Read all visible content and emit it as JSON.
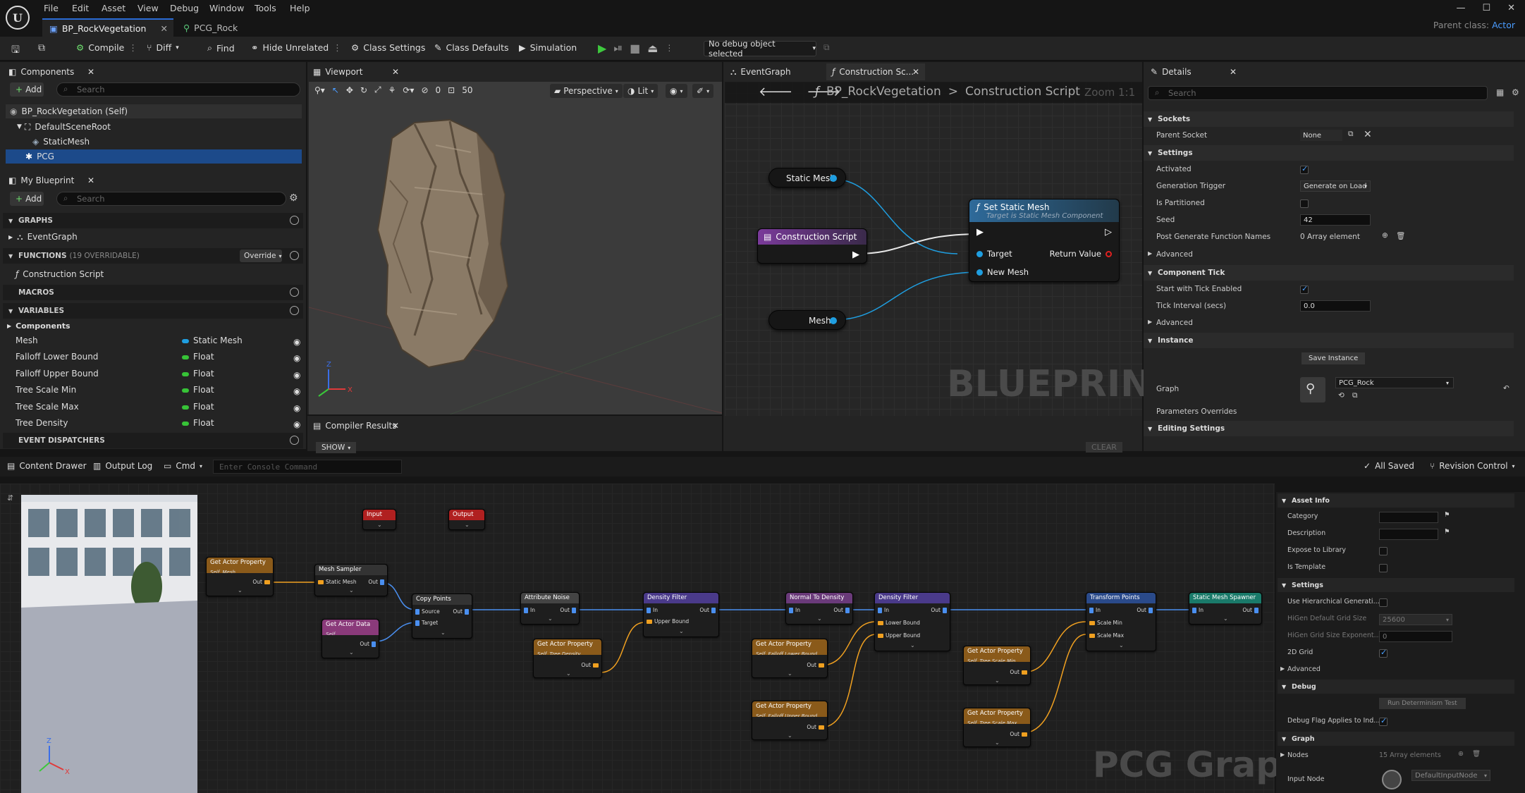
{
  "menu": [
    "File",
    "Edit",
    "Asset",
    "View",
    "Debug",
    "Window",
    "Tools",
    "Help"
  ],
  "tabs": {
    "tab1": "BP_RockVegetation",
    "tab2": "PCG_Rock"
  },
  "parent_class": {
    "label": "Parent class:",
    "value": "Actor"
  },
  "toolbar": {
    "compile": "Compile",
    "diff": "Diff",
    "find": "Find",
    "hide_unrelated": "Hide Unrelated",
    "class_settings": "Class Settings",
    "class_defaults": "Class Defaults",
    "simulation": "Simulation",
    "debug_object": "No debug object selected"
  },
  "components_panel": {
    "title": "Components",
    "add": "Add",
    "search_placeholder": "Search",
    "items": [
      "BP_RockVegetation (Self)",
      "DefaultSceneRoot",
      "StaticMesh",
      "PCG"
    ]
  },
  "my_blueprint": {
    "title": "My Blueprint",
    "add": "Add",
    "search_placeholder": "Search",
    "graphs_header": "GRAPHS",
    "event_graph": "EventGraph",
    "functions_header": "FUNCTIONS",
    "functions_count": "(19 OVERRIDABLE)",
    "override": "Override",
    "construction_script": "Construction Script",
    "macros_header": "MACROS",
    "variables_header": "VARIABLES",
    "components_group": "Components",
    "variables": [
      {
        "name": "Mesh",
        "type": "Static Mesh",
        "color": "#1f9ee0"
      },
      {
        "name": "Falloff Lower Bound",
        "type": "Float",
        "color": "#37c337"
      },
      {
        "name": "Falloff Upper Bound",
        "type": "Float",
        "color": "#37c337"
      },
      {
        "name": "Tree Scale Min",
        "type": "Float",
        "color": "#37c337"
      },
      {
        "name": "Tree Scale Max",
        "type": "Float",
        "color": "#37c337"
      },
      {
        "name": "Tree Density",
        "type": "Float",
        "color": "#37c337"
      }
    ],
    "event_dispatchers": "EVENT DISPATCHERS"
  },
  "viewport": {
    "title": "Viewport",
    "perspective": "Perspective",
    "lit": "Lit",
    "angle": "0",
    "fov": "50"
  },
  "compiler": {
    "title": "Compiler Results",
    "show": "SHOW",
    "clear": "CLEAR"
  },
  "graph_tabs": {
    "event_graph": "EventGraph",
    "construction": "Construction Sc..."
  },
  "graph": {
    "breadcrumb_bp": "BP_RockVegetation",
    "breadcrumb_sep": ">",
    "breadcrumb_fn": "Construction Script",
    "zoom": "Zoom 1:1",
    "watermark": "BLUEPRINT",
    "static_mesh_var": "Static Mesh",
    "construction_node": "Construction Script",
    "set_static_mesh": "Set Static Mesh",
    "set_sub": "Target is Static Mesh Component",
    "target": "Target",
    "return_value": "Return Value",
    "new_mesh": "New Mesh",
    "mesh_var": "Mesh"
  },
  "details": {
    "title": "Details",
    "search_placeholder": "Search",
    "sockets": "Sockets",
    "parent_socket": "Parent Socket",
    "parent_socket_val": "None",
    "settings": "Settings",
    "activated": "Activated",
    "generation_trigger": "Generation Trigger",
    "generation_trigger_val": "Generate on Load",
    "is_partitioned": "Is Partitioned",
    "seed": "Seed",
    "seed_val": "42",
    "post_generate": "Post Generate Function Names",
    "post_generate_val": "0 Array element",
    "advanced": "Advanced",
    "component_tick": "Component Tick",
    "start_tick": "Start with Tick Enabled",
    "tick_interval": "Tick Interval (secs)",
    "tick_interval_val": "0.0",
    "instance": "Instance",
    "save_instance": "Save Instance",
    "graph": "Graph",
    "graph_val": "PCG_Rock",
    "parameters_overrides": "Parameters Overrides",
    "editing_settings": "Editing Settings"
  },
  "bottombar": {
    "content_drawer": "Content Drawer",
    "output_log": "Output Log",
    "cmd": "Cmd",
    "console_placeholder": "Enter Console Command",
    "all_saved": "All Saved",
    "revision_control": "Revision Control"
  },
  "pcg": {
    "watermark": "PCG Graph",
    "input": "Input",
    "output": "Output",
    "get_actor_property": "Get Actor Property",
    "self_mesh": "Self, Mesh",
    "mesh_sampler": "Mesh Sampler",
    "static_mesh": "Static Mesh",
    "get_actor_data": "Get Actor Data",
    "self": "Self",
    "copy_points": "Copy Points",
    "source": "Source",
    "target": "Target",
    "attribute_noise": "Attribute Noise",
    "density_filter": "Density Filter",
    "upper_bound": "Upper Bound",
    "lower_bound": "Lower Bound",
    "self_tree_density": "Self, Tree Density",
    "normal_to_density": "Normal To Density",
    "self_falloff_lower": "Self, Falloff Lower Bound",
    "self_falloff_upper": "Self, Falloff Upper Bound",
    "transform_points": "Transform Points",
    "scale_min": "Scale Min",
    "scale_max": "Scale Max",
    "self_tree_scale_min": "Self, Tree Scale Min",
    "self_tree_scale_max": "Self, Tree Scale Max",
    "static_mesh_spawner": "Static Mesh Spawner",
    "in": "In",
    "out": "Out"
  },
  "pcg_details": {
    "asset_info": "Asset Info",
    "category": "Category",
    "description": "Description",
    "expose": "Expose to Library",
    "is_template": "Is Template",
    "settings": "Settings",
    "use_hier": "Use Hierarchical Generati...",
    "higen_grid": "HiGen Default Grid Size",
    "higen_grid_val": "25600",
    "higen_exp": "HiGen Grid Size Exponent...",
    "higen_exp_val": "0",
    "grid2d": "2D Grid",
    "advanced": "Advanced",
    "debug": "Debug",
    "run_det": "Run Determinism Test",
    "debug_flag": "Debug Flag Applies to Ind...",
    "graph": "Graph",
    "nodes": "Nodes",
    "nodes_val": "15 Array elements",
    "input_node": "Input Node",
    "input_node_val": "DefaultInputNode"
  }
}
